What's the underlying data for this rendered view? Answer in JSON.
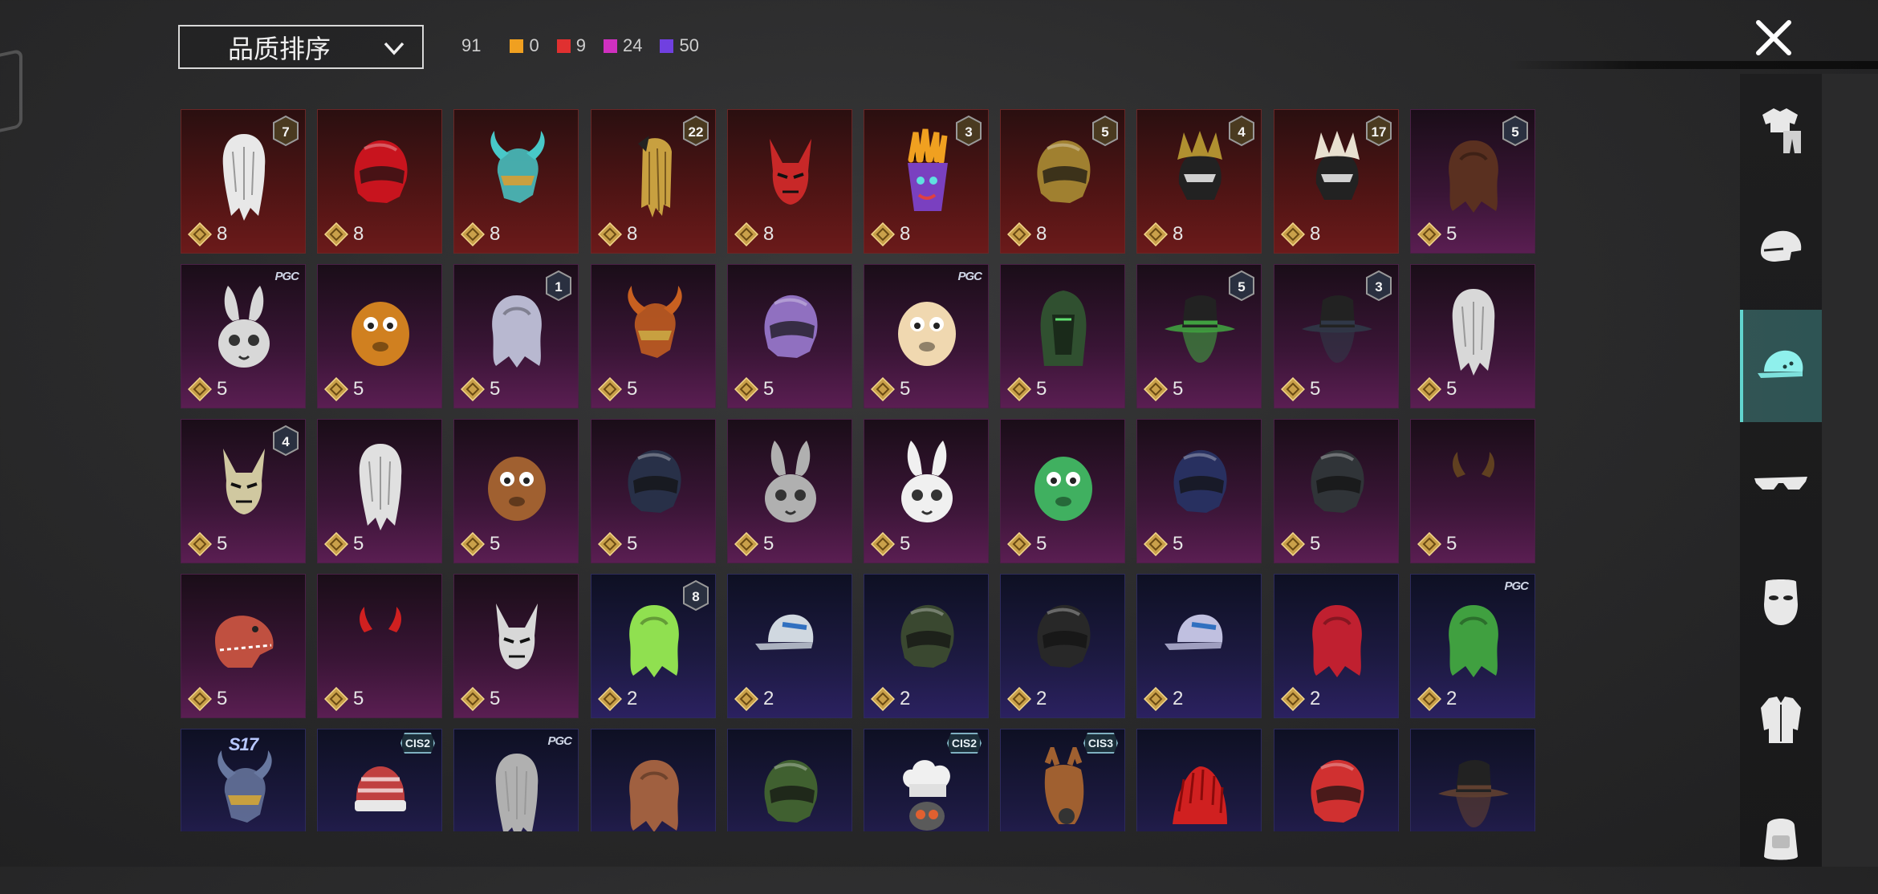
{
  "sort": {
    "label": "品质排序"
  },
  "counts": {
    "total": "91",
    "tiers": [
      {
        "color": "#f0a020",
        "value": "0"
      },
      {
        "color": "#e03030",
        "value": "9"
      },
      {
        "color": "#d030c0",
        "value": "24"
      },
      {
        "color": "#7040e0",
        "value": "50"
      }
    ]
  },
  "side": {
    "items": [
      "outfit-icon",
      "helmet-icon",
      "cap-icon",
      "glasses-icon",
      "mask-icon",
      "jacket-icon",
      "backpack-icon"
    ],
    "active_index": 2
  },
  "items": [
    {
      "rarity": "red",
      "val": "8",
      "lvl": "7",
      "art": "wig-white",
      "c": "#e8e8e8"
    },
    {
      "rarity": "red",
      "val": "8",
      "art": "helmet",
      "c": "#c8141e"
    },
    {
      "rarity": "red",
      "val": "8",
      "art": "horned",
      "c": "#48c8c8"
    },
    {
      "rarity": "red",
      "val": "8",
      "lvl": "22",
      "art": "gold-hair",
      "c": "#c8a040"
    },
    {
      "rarity": "red",
      "val": "8",
      "art": "fox-mask",
      "c": "#c82828"
    },
    {
      "rarity": "red",
      "val": "8",
      "lvl": "3",
      "art": "fries",
      "c": "#f0a020"
    },
    {
      "rarity": "red",
      "val": "8",
      "lvl": "5",
      "art": "helmet",
      "c": "#a08030"
    },
    {
      "rarity": "red",
      "val": "8",
      "lvl": "4",
      "art": "crown",
      "c": "#b09030"
    },
    {
      "rarity": "red",
      "val": "8",
      "lvl": "17",
      "art": "crown",
      "c": "#e8e0d0"
    },
    {
      "rarity": "purple",
      "val": "5",
      "lvl": "5",
      "art": "hair",
      "c": "#5a3020"
    },
    {
      "rarity": "purple",
      "val": "5",
      "tag": "PGC",
      "art": "bunny",
      "c": "#d8d8d8"
    },
    {
      "rarity": "purple",
      "val": "5",
      "art": "blob",
      "c": "#d08020"
    },
    {
      "rarity": "purple",
      "val": "5",
      "lvl": "1",
      "art": "hair",
      "c": "#b8b8d0"
    },
    {
      "rarity": "purple",
      "val": "5",
      "art": "horned",
      "c": "#c86020"
    },
    {
      "rarity": "purple",
      "val": "5",
      "art": "helmet",
      "c": "#9070c0"
    },
    {
      "rarity": "purple",
      "val": "5",
      "tag": "PGC",
      "art": "blob",
      "c": "#f0d8b0"
    },
    {
      "rarity": "purple",
      "val": "5",
      "art": "hood",
      "c": "#305030"
    },
    {
      "rarity": "purple",
      "val": "5",
      "lvl": "5",
      "art": "hat",
      "c": "#40a040"
    },
    {
      "rarity": "purple",
      "val": "5",
      "lvl": "3",
      "art": "hat",
      "c": "#303848"
    },
    {
      "rarity": "purple",
      "val": "5",
      "art": "wig-white",
      "c": "#d8d8d8"
    },
    {
      "rarity": "purple",
      "val": "5",
      "lvl": "4",
      "art": "fox-mask",
      "c": "#d0c8a0"
    },
    {
      "rarity": "purple",
      "val": "5",
      "art": "wig-white",
      "c": "#e0e0e0"
    },
    {
      "rarity": "purple",
      "val": "5",
      "art": "blob",
      "c": "#a06030"
    },
    {
      "rarity": "purple",
      "val": "5",
      "art": "helmet",
      "c": "#283048"
    },
    {
      "rarity": "purple",
      "val": "5",
      "art": "bunny",
      "c": "#b0b0b0"
    },
    {
      "rarity": "purple",
      "val": "5",
      "art": "bunny",
      "c": "#f0f0f0"
    },
    {
      "rarity": "purple",
      "val": "5",
      "art": "blob",
      "c": "#40b060"
    },
    {
      "rarity": "purple",
      "val": "5",
      "art": "helmet",
      "c": "#283060"
    },
    {
      "rarity": "purple",
      "val": "5",
      "art": "helmet",
      "c": "#303438"
    },
    {
      "rarity": "purple",
      "val": "5",
      "art": "horns-small",
      "c": "#604020"
    },
    {
      "rarity": "purple",
      "val": "5",
      "art": "dino",
      "c": "#c05040"
    },
    {
      "rarity": "purple",
      "val": "5",
      "art": "horns-small",
      "c": "#d02020"
    },
    {
      "rarity": "purple",
      "val": "5",
      "art": "fox-mask",
      "c": "#d8d8d8"
    },
    {
      "rarity": "blue",
      "val": "2",
      "lvl": "8",
      "art": "hair",
      "c": "#90e050"
    },
    {
      "rarity": "blue",
      "val": "2",
      "art": "cap",
      "c": "#d0d8e0"
    },
    {
      "rarity": "blue",
      "val": "2",
      "art": "helmet",
      "c": "#3a4830"
    },
    {
      "rarity": "blue",
      "val": "2",
      "art": "helmet",
      "c": "#282828"
    },
    {
      "rarity": "blue",
      "val": "2",
      "art": "cap",
      "c": "#c0c0e0"
    },
    {
      "rarity": "blue",
      "val": "2",
      "art": "hair",
      "c": "#c02030"
    },
    {
      "rarity": "blue",
      "val": "2",
      "tag": "PGC",
      "art": "hair",
      "c": "#40a040"
    },
    {
      "rarity": "blue",
      "val": "",
      "tag": "S17",
      "art": "horned",
      "c": "#6878a0"
    },
    {
      "rarity": "blue",
      "val": "",
      "tag": "CIS2",
      "art": "beanie",
      "c": "#c04040"
    },
    {
      "rarity": "blue",
      "val": "",
      "tag": "PGC",
      "art": "wig-white",
      "c": "#b0b0b0"
    },
    {
      "rarity": "blue",
      "val": "",
      "art": "hair",
      "c": "#a06040"
    },
    {
      "rarity": "blue",
      "val": "",
      "art": "helmet",
      "c": "#406030"
    },
    {
      "rarity": "blue",
      "val": "",
      "tag": "CIS2",
      "art": "chef",
      "c": "#f0f0f0"
    },
    {
      "rarity": "blue",
      "val": "",
      "tag": "CIS3",
      "art": "horse",
      "c": "#a06030"
    },
    {
      "rarity": "blue",
      "val": "",
      "art": "mohawk",
      "c": "#d02020"
    },
    {
      "rarity": "blue",
      "val": "",
      "art": "helmet",
      "c": "#d03030"
    },
    {
      "rarity": "blue",
      "val": "",
      "art": "hat",
      "c": "#604030"
    }
  ]
}
